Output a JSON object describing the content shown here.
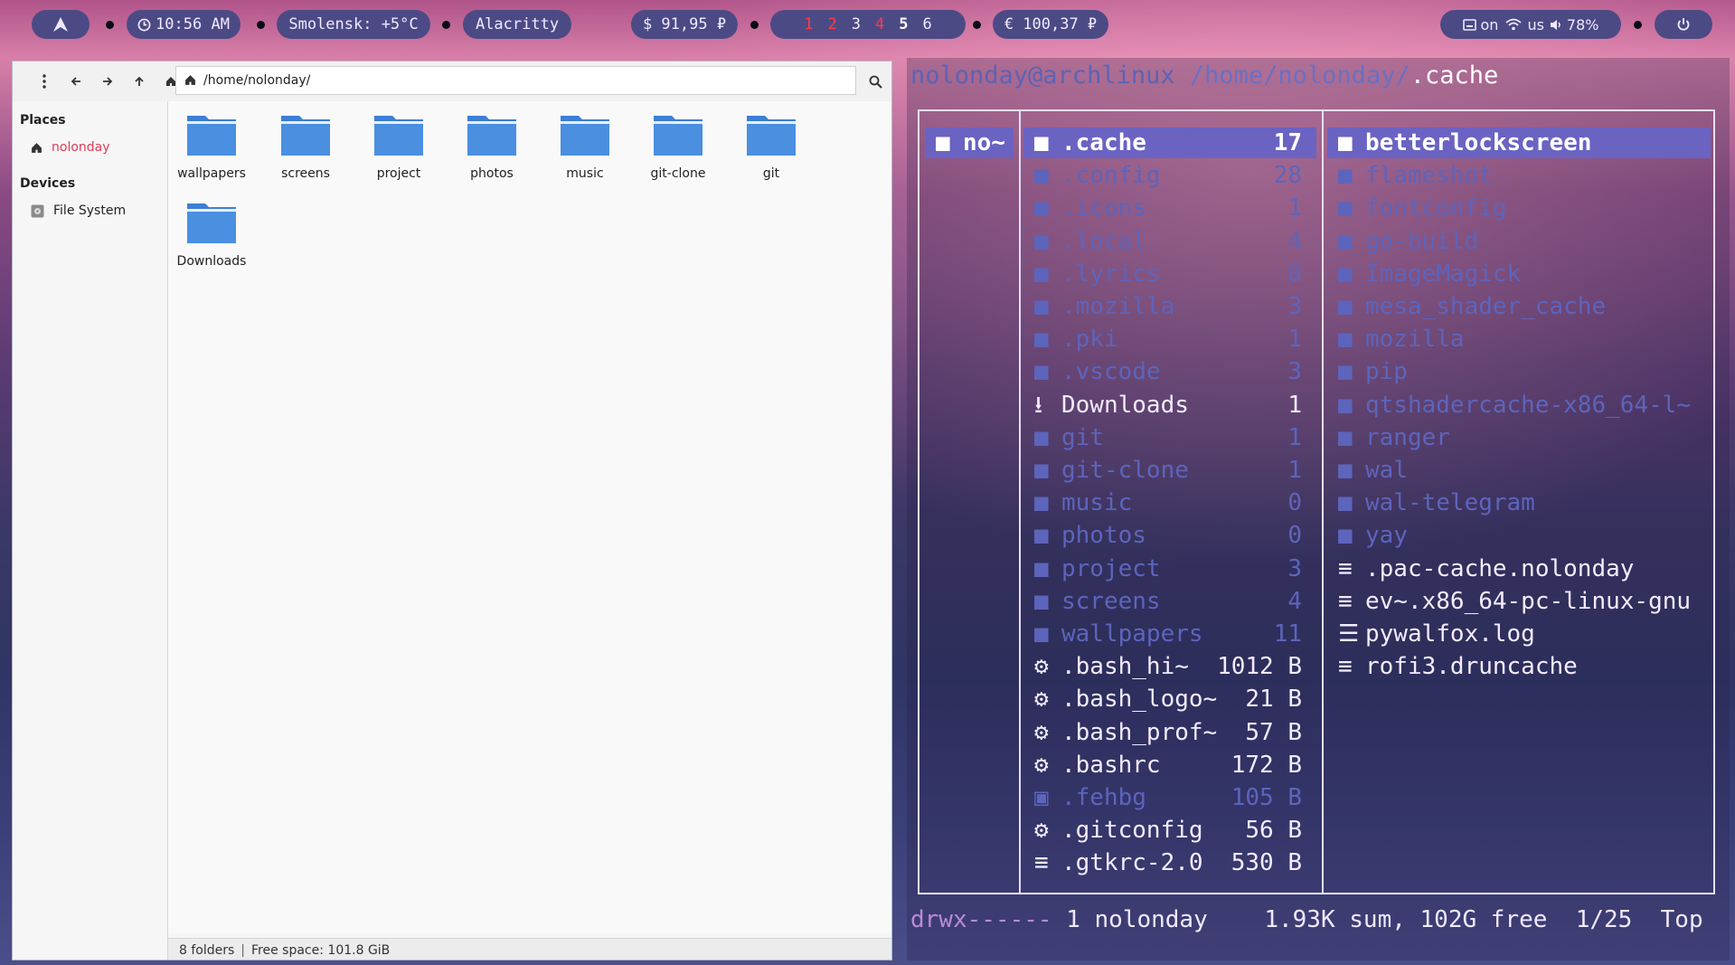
{
  "topbar": {
    "launcher_icon": "arch-logo-icon",
    "clock": "10:56 AM",
    "weather": "Smolensk: +5°C",
    "window_title": "Alacritty",
    "usd": "$ 91,95 ₽",
    "eur": "€ 100,37 ₽",
    "workspaces": [
      "1",
      "2",
      "3",
      "4",
      "5",
      "6"
    ],
    "keyboard_led": "on",
    "layout": "us",
    "volume": "78%",
    "power_icon": "power-icon",
    "colors": {
      "pill": "#4c4a85",
      "urgent": "#ff3b4a"
    }
  },
  "filemanager": {
    "path": "/home/nolonday/",
    "places_heading": "Places",
    "places_item": "nolonday",
    "devices_heading": "Devices",
    "devices_item": "File System",
    "folders": [
      "wallpapers",
      "screens",
      "project",
      "photos",
      "music",
      "git-clone",
      "git",
      "Downloads"
    ],
    "status_count": "8 folders",
    "status_space": "Free space: 101.8 GiB",
    "colors": {
      "folder": "#4a8fe0",
      "accent": "#e03c5a"
    }
  },
  "terminal": {
    "title_user": "nolonday@archlinux",
    "title_path": "/home/nolonday/",
    "title_cur": ".cache",
    "parent_col": "no~",
    "middle": [
      {
        "icon": "folder",
        "name": ".cache",
        "count": "17"
      },
      {
        "icon": "folder",
        "name": ".config",
        "count": "28"
      },
      {
        "icon": "folder",
        "name": ".icons",
        "count": "1"
      },
      {
        "icon": "folder",
        "name": ".local",
        "count": "4"
      },
      {
        "icon": "folder",
        "name": ".lyrics",
        "count": "0"
      },
      {
        "icon": "folder",
        "name": ".mozilla",
        "count": "3"
      },
      {
        "icon": "folder",
        "name": ".pki",
        "count": "1"
      },
      {
        "icon": "folder",
        "name": ".vscode",
        "count": "3"
      },
      {
        "icon": "download",
        "name": "Downloads",
        "count": "1"
      },
      {
        "icon": "folder",
        "name": "git",
        "count": "1"
      },
      {
        "icon": "folder",
        "name": "git-clone",
        "count": "1"
      },
      {
        "icon": "folder",
        "name": "music",
        "count": "0"
      },
      {
        "icon": "folder",
        "name": "photos",
        "count": "0"
      },
      {
        "icon": "folder",
        "name": "project",
        "count": "3"
      },
      {
        "icon": "folder",
        "name": "screens",
        "count": "4"
      },
      {
        "icon": "folder",
        "name": "wallpapers",
        "count": "11"
      },
      {
        "icon": "gear",
        "name": ".bash_hi~",
        "count": "1012 B"
      },
      {
        "icon": "gear",
        "name": ".bash_logo~",
        "count": "21 B"
      },
      {
        "icon": "gear",
        "name": ".bash_prof~",
        "count": "57 B"
      },
      {
        "icon": "gear",
        "name": ".bashrc",
        "count": "172 B"
      },
      {
        "icon": "image",
        "name": ".fehbg",
        "count": "105 B"
      },
      {
        "icon": "gear",
        "name": ".gitconfig",
        "count": "56 B"
      },
      {
        "icon": "text",
        "name": ".gtkrc-2.0",
        "count": "530 B"
      }
    ],
    "right": [
      {
        "icon": "folder",
        "name": "betterlockscreen"
      },
      {
        "icon": "folder",
        "name": "flameshot"
      },
      {
        "icon": "folder",
        "name": "fontconfig"
      },
      {
        "icon": "folder",
        "name": "go-build"
      },
      {
        "icon": "folder",
        "name": "ImageMagick"
      },
      {
        "icon": "folder",
        "name": "mesa_shader_cache"
      },
      {
        "icon": "folder",
        "name": "mozilla"
      },
      {
        "icon": "folder",
        "name": "pip"
      },
      {
        "icon": "folder",
        "name": "qtshadercache-x86_64-l~"
      },
      {
        "icon": "folder",
        "name": "ranger"
      },
      {
        "icon": "folder",
        "name": "wal"
      },
      {
        "icon": "folder",
        "name": "wal-telegram"
      },
      {
        "icon": "folder",
        "name": "yay"
      },
      {
        "icon": "text",
        "name": ".pac-cache.nolonday"
      },
      {
        "icon": "text",
        "name": "ev~.x86_64-pc-linux-gnu"
      },
      {
        "icon": "log",
        "name": "pywalfox.log"
      },
      {
        "icon": "text",
        "name": "rofi3.druncache"
      }
    ],
    "status_perm": "drwx------",
    "status_rest": " 1 nolonday    1.93K sum, 102G free  1/25  Top"
  }
}
